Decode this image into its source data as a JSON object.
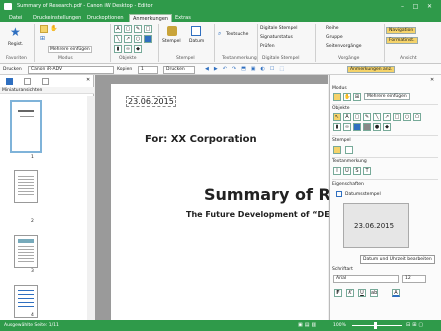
{
  "window": {
    "title": "Summary of Research.pdf - Canon iW Desktop - Editor"
  },
  "tabs": [
    "Datei",
    "Druckeinstellungen",
    "Druckoptionen",
    "Anmerkungen",
    "Extras"
  ],
  "ribbon": {
    "groups": {
      "favoriten": "Favoriten",
      "modus": "Modus",
      "objekte": "Objekte",
      "stempel": "Stempel",
      "textanmerkung": "Textanmerkung",
      "digitale_stempel": "Digitale Stempel",
      "vorgaenge": "Vorgänge",
      "ansicht": "Ansicht"
    },
    "regist": "Regist.",
    "mehrere": "Mehrere einfügen",
    "stempel": "Stempel",
    "datum": "Datum",
    "textsuche": "Textsuche",
    "dig_stempel": "Digitale Stempel",
    "signaturstatus": "Signaturstatus",
    "pruefen": "Prüfen",
    "reihe": "Reihe",
    "gruppe": "Gruppe",
    "seitenvorgaenge": "Seitenvorgänge",
    "navigation": "Navigation",
    "formatinst": "Formatinst."
  },
  "toolbar": {
    "drucken_label": "Drucken",
    "printer": "Canon iR-ADV",
    "kopien_label": "Kopien",
    "kopien_value": "1",
    "drucken_btn": "Drucken",
    "anmerkungen_ans": "Anmerkungen anz."
  },
  "left": {
    "title": "Miniaturansichten",
    "pages": [
      "1",
      "2",
      "3",
      "4"
    ]
  },
  "document": {
    "date_stamp": "23.06.2015",
    "for_line": "For: XX Corporation",
    "title": "Summary of Res",
    "subtitle": "The Future Development of “DE LA"
  },
  "right": {
    "modus": "Modus",
    "mehrere": "Mehrere einfügen",
    "objekte": "Objekte",
    "stempel": "Stempel",
    "textanmerkung": "Textanmerkung",
    "eigenschaften": "Eigenschaften",
    "datumsstempel": "Datumsstempel",
    "preview_date": "23.06.2015",
    "tooltip": "Datum und Uhrzeit bearbeiten",
    "schriftart": "Schriftart",
    "font": "Arial",
    "fontsize": "12"
  },
  "status": {
    "left": "Ausgewählte Seite: 1/11",
    "zoom": "100%"
  },
  "colors": {
    "title_bar": "#2f9a4a",
    "accent_blue": "#2f6fc0",
    "nav_highlight": "#f5d36a"
  }
}
